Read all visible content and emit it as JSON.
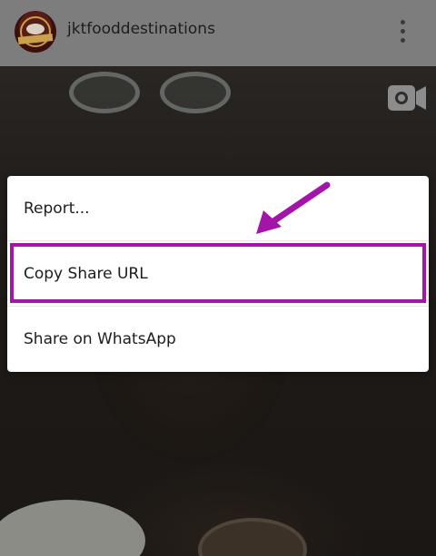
{
  "header": {
    "username": "jktfooddestinations",
    "avatar_icon": "account-avatar-icon",
    "more_icon": "more-vertical-icon"
  },
  "media": {
    "type_icon": "video-camera-icon"
  },
  "menu": {
    "items": [
      {
        "label": "Report..."
      },
      {
        "label": "Copy Share URL"
      },
      {
        "label": "Share on WhatsApp"
      }
    ],
    "highlight_color": "#a314a8"
  }
}
